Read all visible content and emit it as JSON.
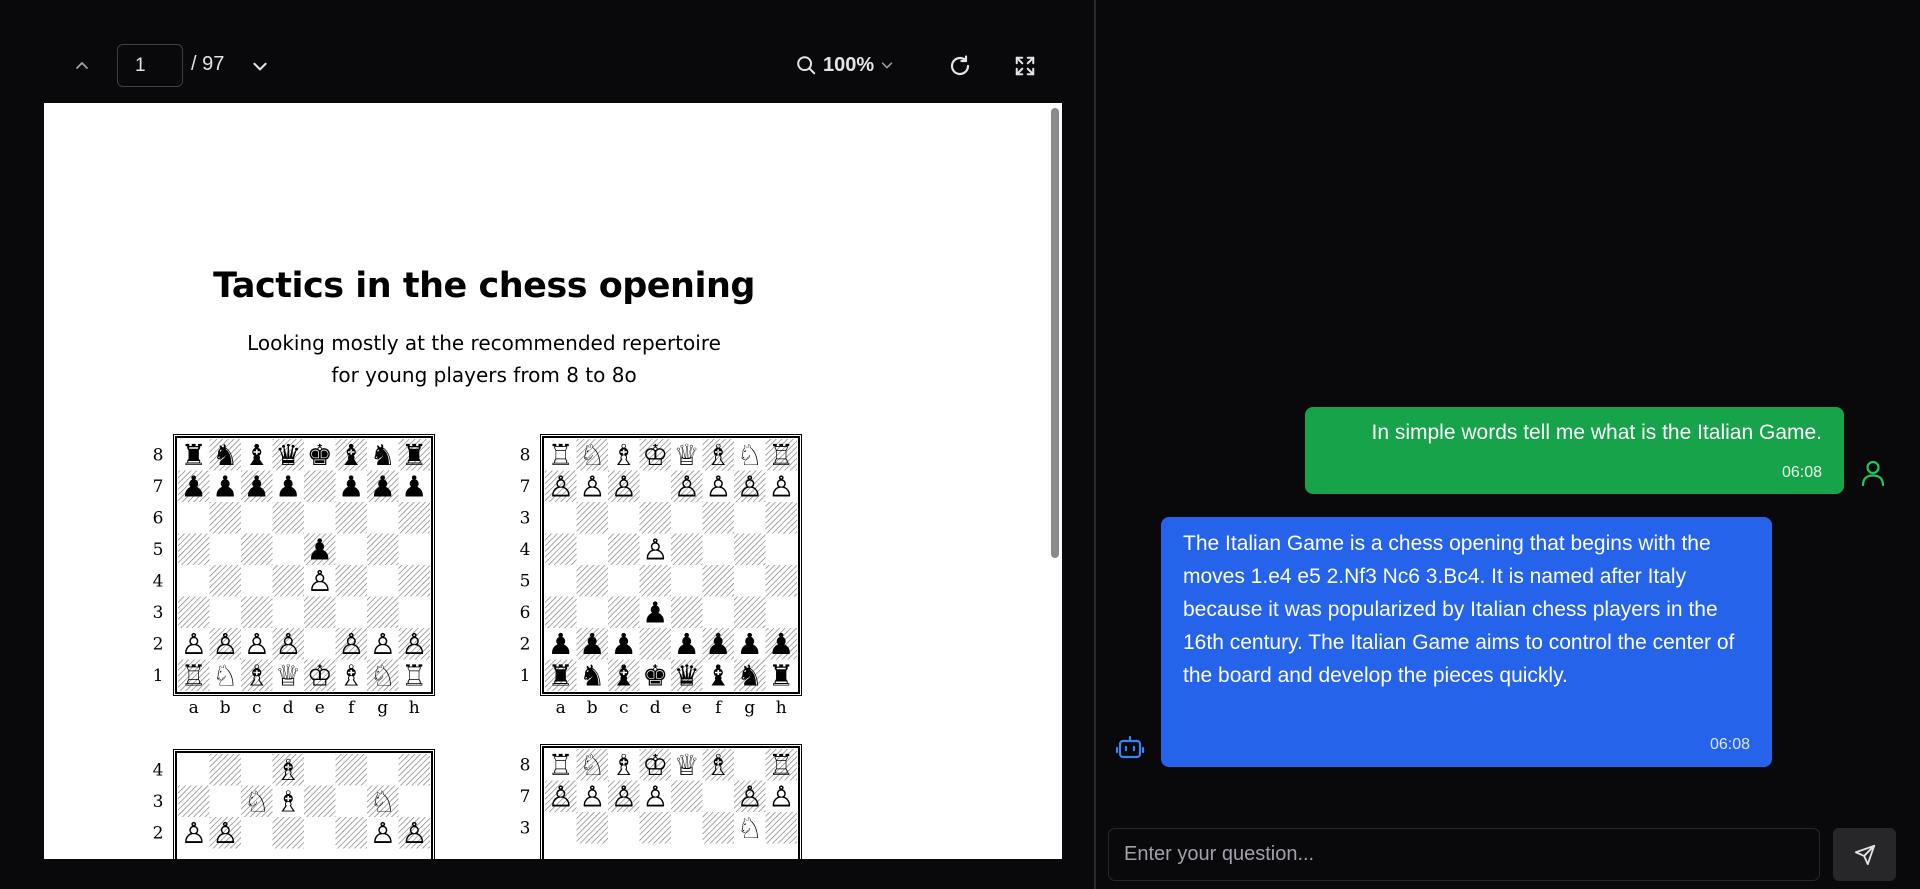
{
  "pdf_toolbar": {
    "page_current": "1",
    "page_total": "/ 97",
    "zoom_level": "100%"
  },
  "document": {
    "title": "Tactics in the chess opening",
    "subtitle_line1": "Looking mostly at the recommended repertoire",
    "subtitle_line2": "for young players from 8 to 8o",
    "boards": [
      {
        "ranks": [
          "8",
          "7",
          "6",
          "5",
          "4",
          "3",
          "2",
          "1"
        ],
        "files": [
          "a",
          "b",
          "c",
          "d",
          "e",
          "f",
          "g",
          "h"
        ],
        "position": [
          "rnbqkbnr",
          "pppp.ppp",
          "........",
          "....p...",
          "....P...",
          "........",
          "PPPP.PPP",
          "RNBQKBNR"
        ]
      },
      {
        "ranks": [
          "8",
          "7",
          "3",
          "4",
          "5",
          "6",
          "2",
          "1"
        ],
        "files": [
          "a",
          "b",
          "c",
          "d",
          "e",
          "f",
          "g",
          "h"
        ],
        "position": [
          "RNBKQBNR",
          "PPP.PPPP",
          "........",
          "...P....",
          "........",
          "...p....",
          "ppp.pppp",
          "rnbkqbnr"
        ]
      },
      {
        "ranks": [
          "4",
          "3",
          "2"
        ],
        "files": [],
        "position": [
          "...B....",
          "..NB..N.",
          "PP....PP"
        ]
      },
      {
        "ranks": [
          "8",
          "7",
          "3"
        ],
        "files": [],
        "position": [
          "RNBKQB.R",
          "PPPP..PP",
          "......N."
        ]
      }
    ]
  },
  "chat": {
    "messages": [
      {
        "role": "user",
        "text": "In simple words tell me what is the Italian Game.",
        "time": "06:08"
      },
      {
        "role": "assistant",
        "text": "The Italian Game is a chess opening that begins with the moves 1.e4 e5 2.Nf3 Nc6 3.Bc4. It is named after Italy because it was popularized by Italian chess players in the 16th century. The Italian Game aims to control the center of the board and develop the pieces quickly.",
        "time": "06:08"
      }
    ],
    "input_placeholder": "Enter your question...",
    "user_color": "#16a34a",
    "assistant_color": "#2563eb"
  }
}
